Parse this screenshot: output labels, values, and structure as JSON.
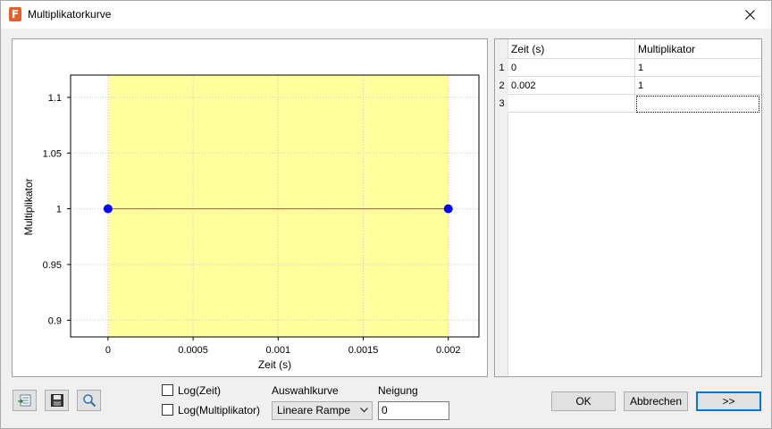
{
  "window": {
    "title": "Multiplikatorkurve",
    "app_icon_letter": "F"
  },
  "plot": {
    "ylabel": "Multiplikator",
    "xlabel": "Zeit (s)",
    "y_ticks": [
      "1.1",
      "1.05",
      "1",
      "0.95",
      "0.9"
    ],
    "x_ticks": [
      "0",
      "0.0005",
      "0.001",
      "0.0015",
      "0.002"
    ],
    "colors": {
      "highlight": "#ffff9e",
      "line": "#e8413c",
      "points": "#0000ff",
      "grid": "#c8c8c8"
    }
  },
  "chart_data": {
    "type": "line",
    "x": [
      0,
      0.002
    ],
    "series": [
      {
        "values": [
          1,
          1
        ]
      }
    ],
    "xlabel": "Zeit (s)",
    "ylabel": "Multiplikator",
    "xlim": [
      -0.00022,
      0.00218
    ],
    "ylim": [
      0.885,
      1.12
    ],
    "grid": true,
    "highlight_span": [
      0,
      0.002
    ]
  },
  "table": {
    "columns": [
      "Zeit (s)",
      "Multiplikator"
    ],
    "rows": [
      {
        "num": "1",
        "zeit": "0",
        "mult": "1"
      },
      {
        "num": "2",
        "zeit": "0.002",
        "mult": "1"
      },
      {
        "num": "3",
        "zeit": "",
        "mult": ""
      }
    ]
  },
  "options": {
    "log_zeit_label": "Log(Zeit)",
    "log_mult_label": "Log(Multiplikator)",
    "auswahlkurve_label": "Auswahlkurve",
    "auswahlkurve_value": "Lineare Rampe",
    "neigung_label": "Neigung",
    "neigung_value": "0"
  },
  "toolbar": {
    "icons": [
      "import-icon",
      "save-icon",
      "zoom-icon"
    ]
  },
  "buttons": {
    "ok": "OK",
    "cancel": "Abbrechen",
    "expand": ">>"
  }
}
